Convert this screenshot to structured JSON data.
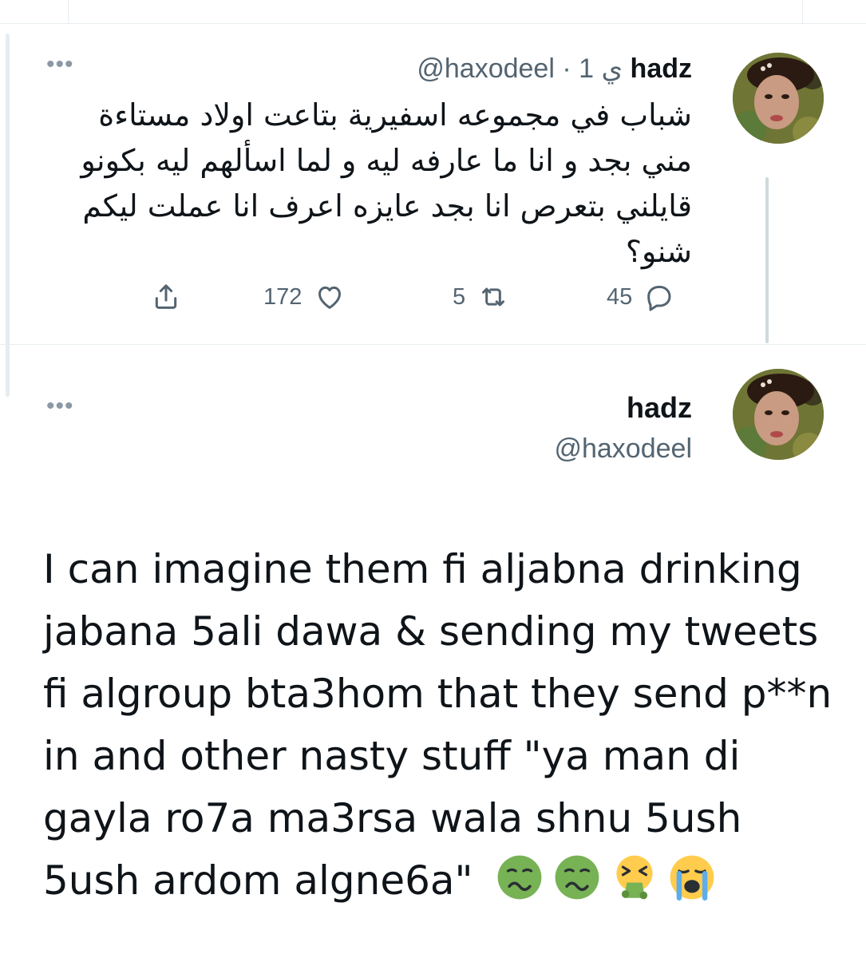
{
  "parent_tweet": {
    "author_name": "hadz",
    "handle_time": "@haxodeel · 1 ي",
    "text": "شباب في مجموعه اسفيرية بتاعت اولاد مستاءة مني بجد و انا ما عارفه ليه و لما اسألهم ليه بكونو قايلني بتعرص انا بجد عايزه اعرف انا عملت ليكم شنو؟",
    "replies": "45",
    "retweets": "5",
    "likes": "172"
  },
  "main_tweet": {
    "author_name": "hadz",
    "handle": "@haxodeel",
    "text": "I can imagine them fi aljabna drinking jabana 5ali dawa & sending my tweets fi algroup bta3hom that they send p**n in and other nasty stuff \"ya man di gayla ro7a ma3rsa wala shnu 5ush 5ush ardom algne6a\"",
    "emojis": [
      "nauseated-face",
      "nauseated-face",
      "face-vomiting",
      "loudly-crying-face"
    ]
  },
  "colors": {
    "text_primary": "#0f1419",
    "text_secondary": "#536471",
    "divider": "#e6ecf0",
    "thread_line": "#cfd9de"
  },
  "icons": {
    "more": "more-horizontal-icon",
    "reply": "reply-bubble-icon",
    "retweet": "retweet-icon",
    "like": "heart-icon",
    "share": "share-upload-icon"
  }
}
